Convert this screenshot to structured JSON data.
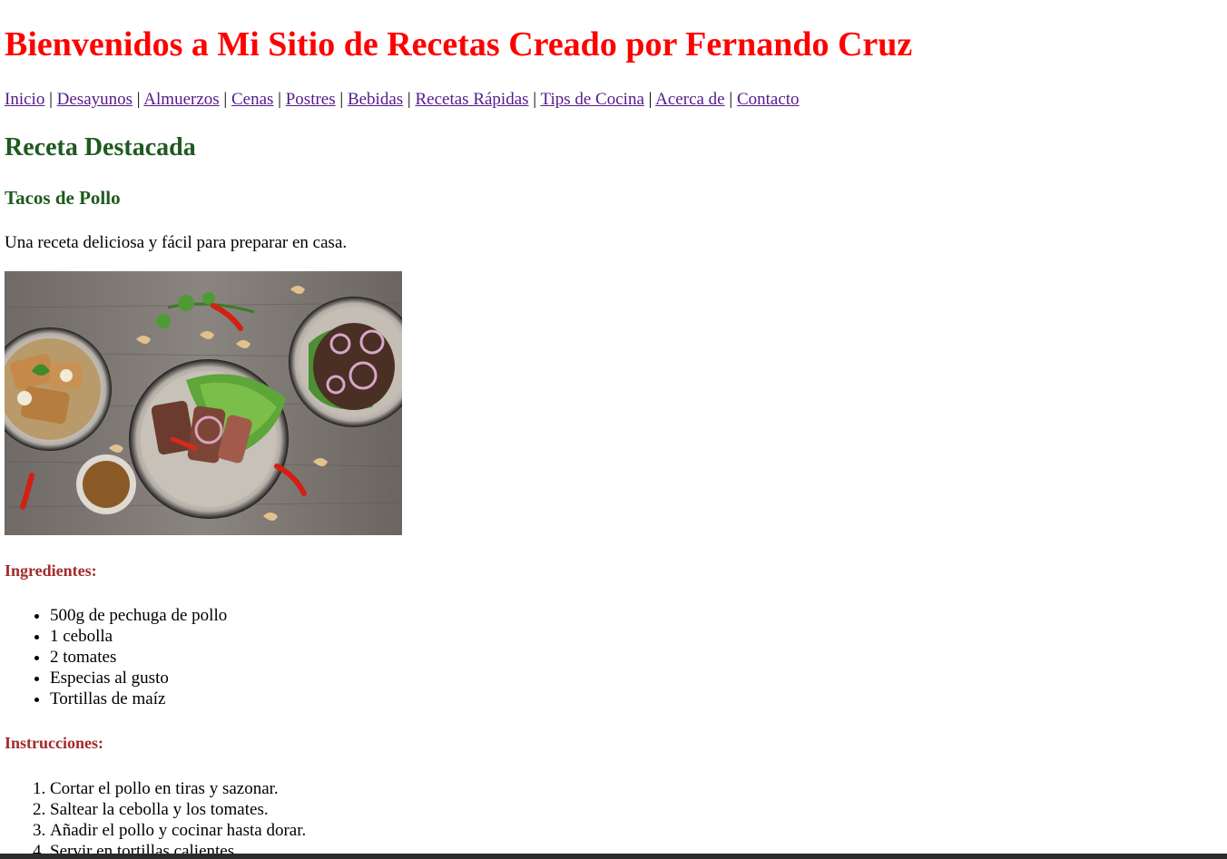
{
  "header": {
    "title": "Bienvenidos a Mi Sitio de Recetas Creado por Fernando Cruz"
  },
  "nav": {
    "separator": "|",
    "items": [
      {
        "label": "Inicio"
      },
      {
        "label": "Desayunos"
      },
      {
        "label": "Almuerzos"
      },
      {
        "label": "Cenas"
      },
      {
        "label": "Postres"
      },
      {
        "label": "Bebidas"
      },
      {
        "label": "Recetas Rápidas"
      },
      {
        "label": "Tips de Cocina"
      },
      {
        "label": "Acerca de"
      },
      {
        "label": "Contacto"
      }
    ]
  },
  "featured": {
    "heading": "Receta Destacada",
    "recipe_name": "Tacos de Pollo",
    "description": "Una receta deliciosa y fácil para preparar en casa."
  },
  "ingredients": {
    "heading": "Ingredientes:",
    "items": [
      "500g de pechuga de pollo",
      "1 cebolla",
      "2 tomates",
      "Especias al gusto",
      "Tortillas de maíz"
    ]
  },
  "instructions": {
    "heading": "Instrucciones:",
    "steps": [
      "Cortar el pollo en tiras y sazonar.",
      "Saltear la cebolla y los tomates.",
      "Añadir el pollo y cocinar hasta dorar.",
      "Servir en tortillas calientes."
    ]
  },
  "colors": {
    "title": "#ff0000",
    "link": "#551a8b",
    "section_green": "#1e5a1e",
    "subsection_brown": "#a52a2a"
  }
}
